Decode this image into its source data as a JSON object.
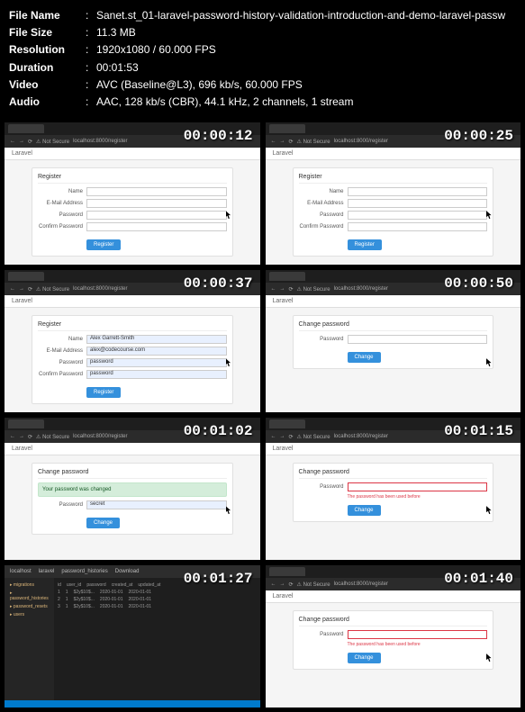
{
  "meta": {
    "filename_label": "File Name",
    "filesize_label": "File Size",
    "resolution_label": "Resolution",
    "duration_label": "Duration",
    "video_label": "Video",
    "audio_label": "Audio",
    "filename": "Sanet.st_01-laravel-password-history-validation-introduction-and-demo-laravel-passw",
    "filesize": "11.3 MB",
    "resolution": "1920x1080 / 60.000 FPS",
    "duration": "00:01:53",
    "video": "AVC (Baseline@L3), 696 kb/s, 60.000 FPS",
    "audio": "AAC, 128 kb/s (CBR), 44.1 kHz, 2 channels, 1 stream"
  },
  "thumbs": [
    {
      "ts": "00:00:12",
      "type": "register",
      "addr": "Not Secure",
      "app": "Laravel",
      "title": "Register",
      "fields": [
        {
          "l": "Name",
          "v": ""
        },
        {
          "l": "E-Mail Address",
          "v": ""
        },
        {
          "l": "Password",
          "v": ""
        },
        {
          "l": "Confirm Password",
          "v": ""
        }
      ],
      "btn": "Register"
    },
    {
      "ts": "00:00:25",
      "type": "register",
      "addr": "Not Secure",
      "app": "Laravel",
      "title": "Register",
      "fields": [
        {
          "l": "Name",
          "v": ""
        },
        {
          "l": "E-Mail Address",
          "v": ""
        },
        {
          "l": "Password",
          "v": ""
        },
        {
          "l": "Confirm Password",
          "v": ""
        }
      ],
      "btn": "Register"
    },
    {
      "ts": "00:00:37",
      "type": "register",
      "addr": "Not Secure",
      "app": "Laravel",
      "title": "Register",
      "fields": [
        {
          "l": "Name",
          "v": "Alex Garrett-Smith",
          "f": true
        },
        {
          "l": "E-Mail Address",
          "v": "alex@codecourse.com",
          "f": true
        },
        {
          "l": "Password",
          "v": "password",
          "f": true
        },
        {
          "l": "Confirm Password",
          "v": "password",
          "f": true
        }
      ],
      "btn": "Register"
    },
    {
      "ts": "00:00:50",
      "type": "change",
      "addr": "Not Secure",
      "app": "Laravel",
      "title": "Change password",
      "fields": [
        {
          "l": "Password",
          "v": ""
        }
      ],
      "btn": "Change"
    },
    {
      "ts": "00:01:02",
      "type": "change_success",
      "addr": "Not Secure",
      "app": "Laravel",
      "title": "Change password",
      "success": "Your password was changed",
      "fields": [
        {
          "l": "Password",
          "v": "secret",
          "f": true
        }
      ],
      "btn": "Change"
    },
    {
      "ts": "00:01:15",
      "type": "change_error",
      "addr": "Not Secure",
      "app": "Laravel",
      "title": "Change password",
      "fields": [
        {
          "l": "Password",
          "v": "",
          "e": true
        }
      ],
      "error": "The password has been used before",
      "btn": "Change"
    },
    {
      "ts": "00:01:27",
      "type": "ide",
      "top": [
        "localhost",
        "laravel",
        "password_histories",
        "Download"
      ],
      "files": [
        "migrations",
        "password_histories",
        "password_resets",
        "users"
      ],
      "cols": [
        "id",
        "user_id",
        "password",
        "created_at",
        "updated_at"
      ]
    },
    {
      "ts": "00:01:40",
      "type": "change_error",
      "addr": "Not Secure",
      "app": "Laravel",
      "title": "Change password",
      "fields": [
        {
          "l": "Password",
          "v": "",
          "e": true
        }
      ],
      "error": "The password has been used before",
      "btn": "Change"
    }
  ]
}
